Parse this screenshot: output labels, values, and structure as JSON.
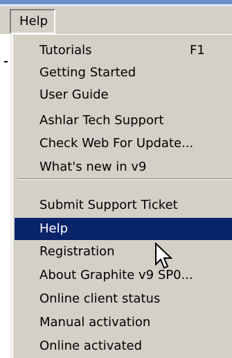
{
  "menubar": {
    "help_label": "Help"
  },
  "help_menu": {
    "items_group1": [
      {
        "label": "Tutorials",
        "shortcut": "F1"
      },
      {
        "label": "Getting Started"
      },
      {
        "label": "User Guide"
      },
      {
        "label": "Ashlar Tech Support"
      },
      {
        "label": "Check Web For Update..."
      },
      {
        "label": "What's new in v9"
      }
    ],
    "items_group2": [
      {
        "label": "Submit Support Ticket"
      },
      {
        "label": "Help",
        "highlighted": true
      },
      {
        "label": "Registration"
      },
      {
        "label": "About Graphite v9 SP0..."
      },
      {
        "label": "Online client status"
      },
      {
        "label": "Manual activation"
      },
      {
        "label": "Online activated"
      }
    ]
  },
  "colors": {
    "highlight_bg": "#0a246a",
    "highlight_fg": "#ffffff",
    "menu_bg": "#d4d0c8"
  },
  "cursor": "arrow-pointer-icon"
}
